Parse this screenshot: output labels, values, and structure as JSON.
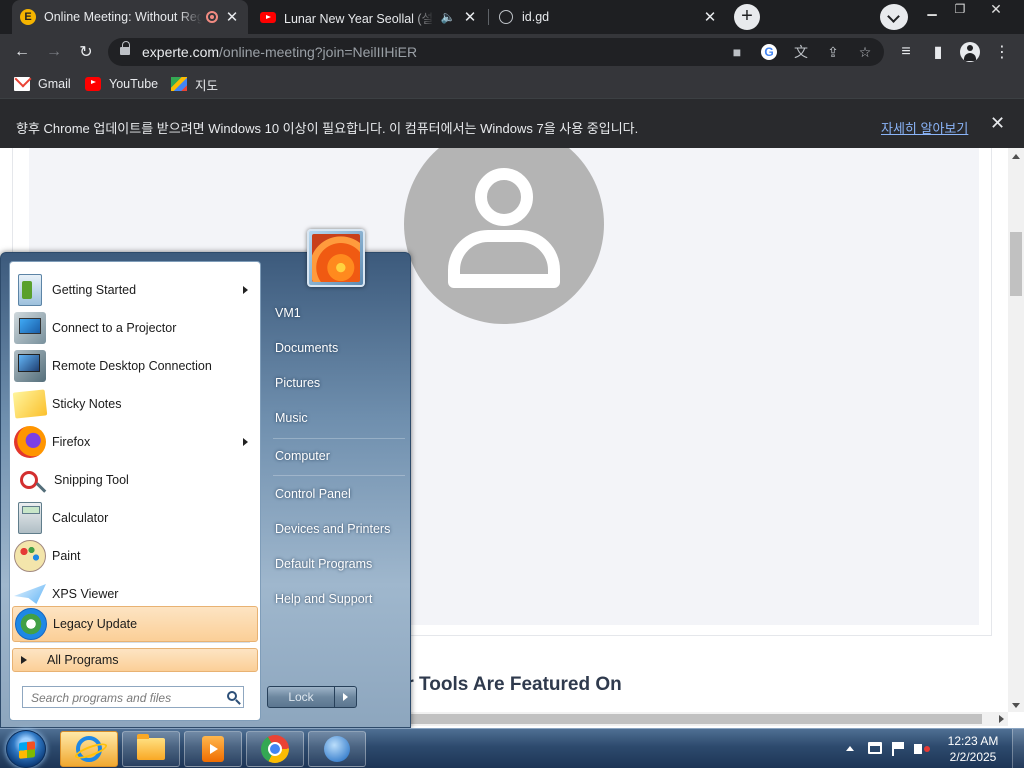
{
  "browser": {
    "tabs": [
      {
        "title": "Online Meeting: Without Registration",
        "favicon": "e-letter-icon",
        "recording": true,
        "active": true
      },
      {
        "title": "Lunar New Year Seollal (설날)",
        "favicon": "youtube-icon",
        "audio": true,
        "active": false
      },
      {
        "title": "id.gd",
        "favicon": "globe-icon",
        "active": false
      }
    ],
    "url_domain": "experte.com",
    "url_path": "/online-meeting?join=NeilIIHiER",
    "bookmarks": [
      {
        "label": "Gmail",
        "icon": "gmail-icon"
      },
      {
        "label": "YouTube",
        "icon": "youtube-icon"
      },
      {
        "label": "지도",
        "icon": "maps-icon"
      }
    ],
    "infobar": {
      "message": "향후 Chrome 업데이트를 받으려면 Windows 10 이상이 필요합니다. 이 컴퓨터에서는 Windows 7을 사용 중입니다.",
      "link": "자세히 알아보기"
    }
  },
  "page": {
    "section_heading": "Our Tools Are Featured On"
  },
  "start_menu": {
    "programs": [
      {
        "label": "Getting Started",
        "icon": "getting-started-icon",
        "submenu": true
      },
      {
        "label": "Connect to a Projector",
        "icon": "projector-icon",
        "submenu": false
      },
      {
        "label": "Remote Desktop Connection",
        "icon": "remote-desktop-icon",
        "submenu": false
      },
      {
        "label": "Sticky Notes",
        "icon": "sticky-notes-icon",
        "submenu": false
      },
      {
        "label": "Firefox",
        "icon": "firefox-icon",
        "submenu": true
      },
      {
        "label": "Snipping Tool",
        "icon": "snipping-tool-icon",
        "submenu": false
      },
      {
        "label": "Calculator",
        "icon": "calculator-icon",
        "submenu": false
      },
      {
        "label": "Paint",
        "icon": "paint-icon",
        "submenu": false
      },
      {
        "label": "XPS Viewer",
        "icon": "xps-viewer-icon",
        "submenu": false
      },
      {
        "label": "Legacy Update",
        "icon": "legacy-update-icon",
        "submenu": false,
        "highlighted": true
      }
    ],
    "all_programs": "All Programs",
    "search_placeholder": "Search programs and files",
    "right_items": {
      "user": "VM1",
      "documents": "Documents",
      "pictures": "Pictures",
      "music": "Music",
      "computer": "Computer",
      "control_panel": "Control Panel",
      "devices": "Devices and Printers",
      "default_programs": "Default Programs",
      "help": "Help and Support"
    },
    "lock_label": "Lock"
  },
  "taskbar": {
    "pinned": [
      "internet-explorer-icon",
      "file-explorer-icon",
      "media-player-icon",
      "chrome-icon",
      "network-globe-icon"
    ],
    "time": "12:23 AM",
    "date": "2/2/2025"
  }
}
